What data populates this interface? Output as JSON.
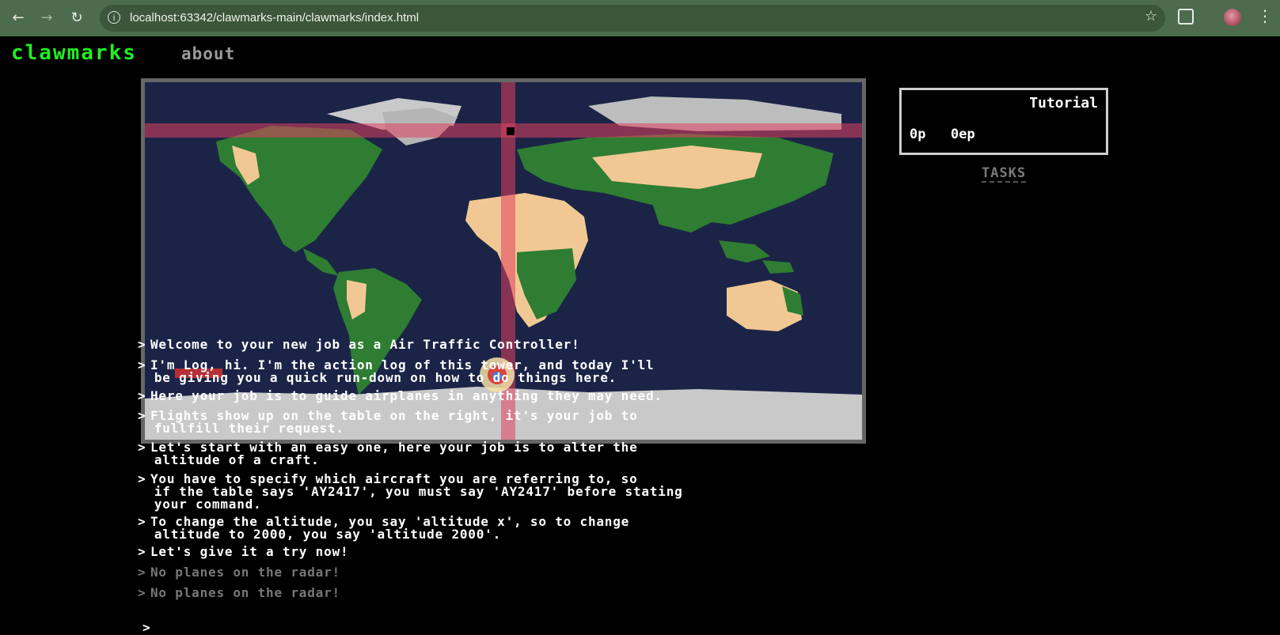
{
  "browser": {
    "url": "localhost:63342/clawmarks-main/clawmarks/index.html"
  },
  "site": {
    "brand": "clawmarks",
    "nav_about": "about"
  },
  "panel": {
    "title": "Tutorial",
    "points": "0p",
    "extra_points": "0ep",
    "tasks_label": "TASKS"
  },
  "map": {
    "ocean_color": "#1b2447",
    "crosshair_color": "#e0405e"
  },
  "log": {
    "caret": ">",
    "lines": [
      {
        "text": "Welcome to your new job as a Air Traffic Controller!"
      },
      {
        "text": "I'm Log, hi. I'm the action log of this tower, and today I'll\nbe giving you a quick run-down on how to do things here."
      },
      {
        "text": "Here your job is to guide airplanes in anything they may need."
      },
      {
        "text": "Flights show up on the table on the right, it's your job to\nfullfill their request."
      },
      {
        "text": "Let's start with an easy one, here your job is to alter the\naltitude of a craft."
      },
      {
        "text": "You have to specify which aircraft you are referring to, so\nif the table says 'AY2417', you must say 'AY2417' before stating\nyour command."
      },
      {
        "text": "To change the altitude, you say 'altitude x', so to change\naltitude to 2000, you say 'altitude 2000'."
      },
      {
        "text": "Let's give it a try now!"
      },
      {
        "text": "No planes on the radar!"
      },
      {
        "text": "No planes on the radar!"
      }
    ],
    "prompt": ">"
  }
}
